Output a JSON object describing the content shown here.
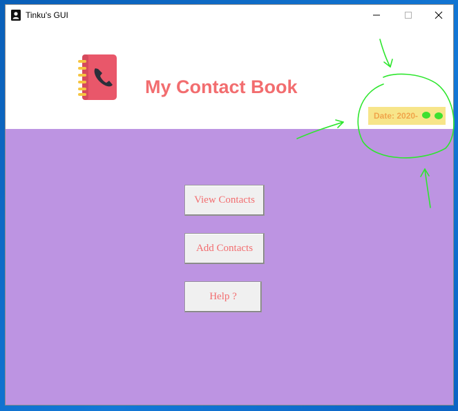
{
  "window": {
    "title": "Tinku's GUI",
    "controls": {
      "minimize": "minimize",
      "maximize": "maximize",
      "close": "close"
    }
  },
  "header": {
    "title": "My Contact Book",
    "date_label": "Date: 2020-",
    "icon": "contact-book-icon"
  },
  "main": {
    "buttons": [
      {
        "label": "View Contacts"
      },
      {
        "label": "Add Contacts"
      },
      {
        "label": "Help ?"
      }
    ]
  },
  "colors": {
    "accent": "#f26d6f",
    "body_bg": "#bd94e2",
    "date_bg": "#f7e58a",
    "date_text": "#f0a54a",
    "annotation": "#2ee62e"
  }
}
